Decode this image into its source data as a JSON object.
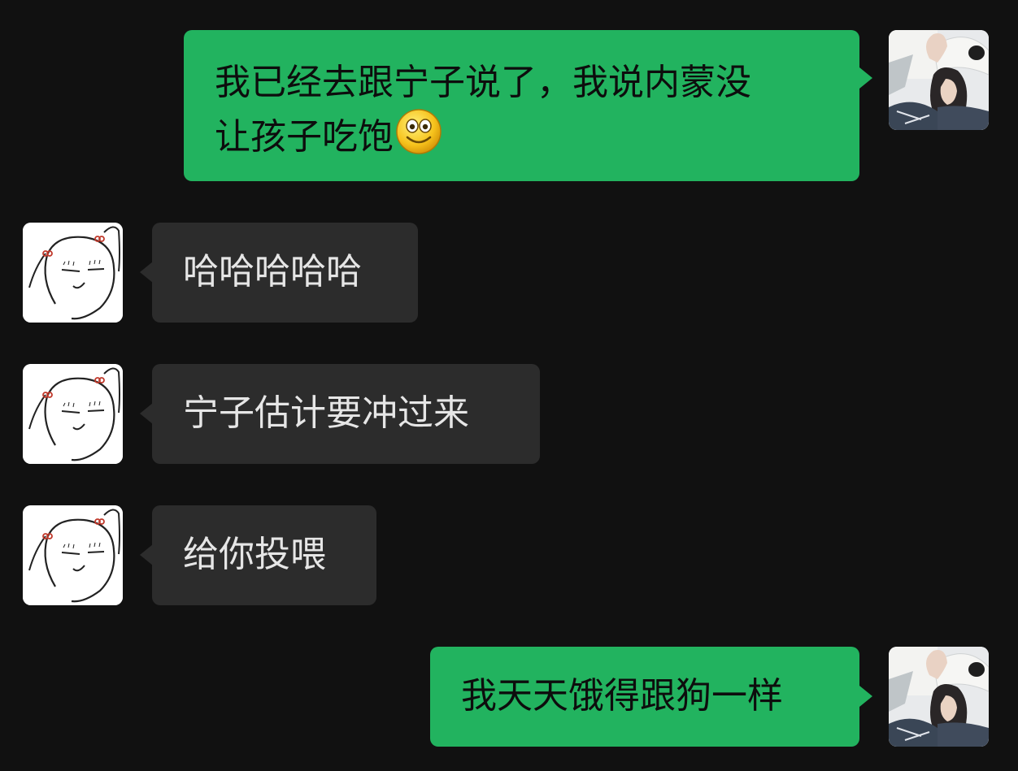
{
  "messages": [
    {
      "direction": "outgoing",
      "lines": [
        "我已经去跟宁子说了，我说内蒙没",
        "让孩子吃饱"
      ],
      "emoji": "smiling-face-emoji"
    },
    {
      "direction": "incoming",
      "text": "哈哈哈哈哈"
    },
    {
      "direction": "incoming",
      "text": "宁子估计要冲过来"
    },
    {
      "direction": "incoming",
      "text": "给你投喂"
    },
    {
      "direction": "outgoing",
      "text": "我天天饿得跟狗一样"
    }
  ],
  "colors": {
    "background": "#111111",
    "outgoing_bubble": "#22b35f",
    "incoming_bubble": "#2c2c2c",
    "outgoing_text": "#0d0d0d",
    "incoming_text": "#e6e6e6"
  },
  "avatars": {
    "self": "girl-with-hat-photo-avatar",
    "contact": "doodle-girl-face-avatar"
  }
}
